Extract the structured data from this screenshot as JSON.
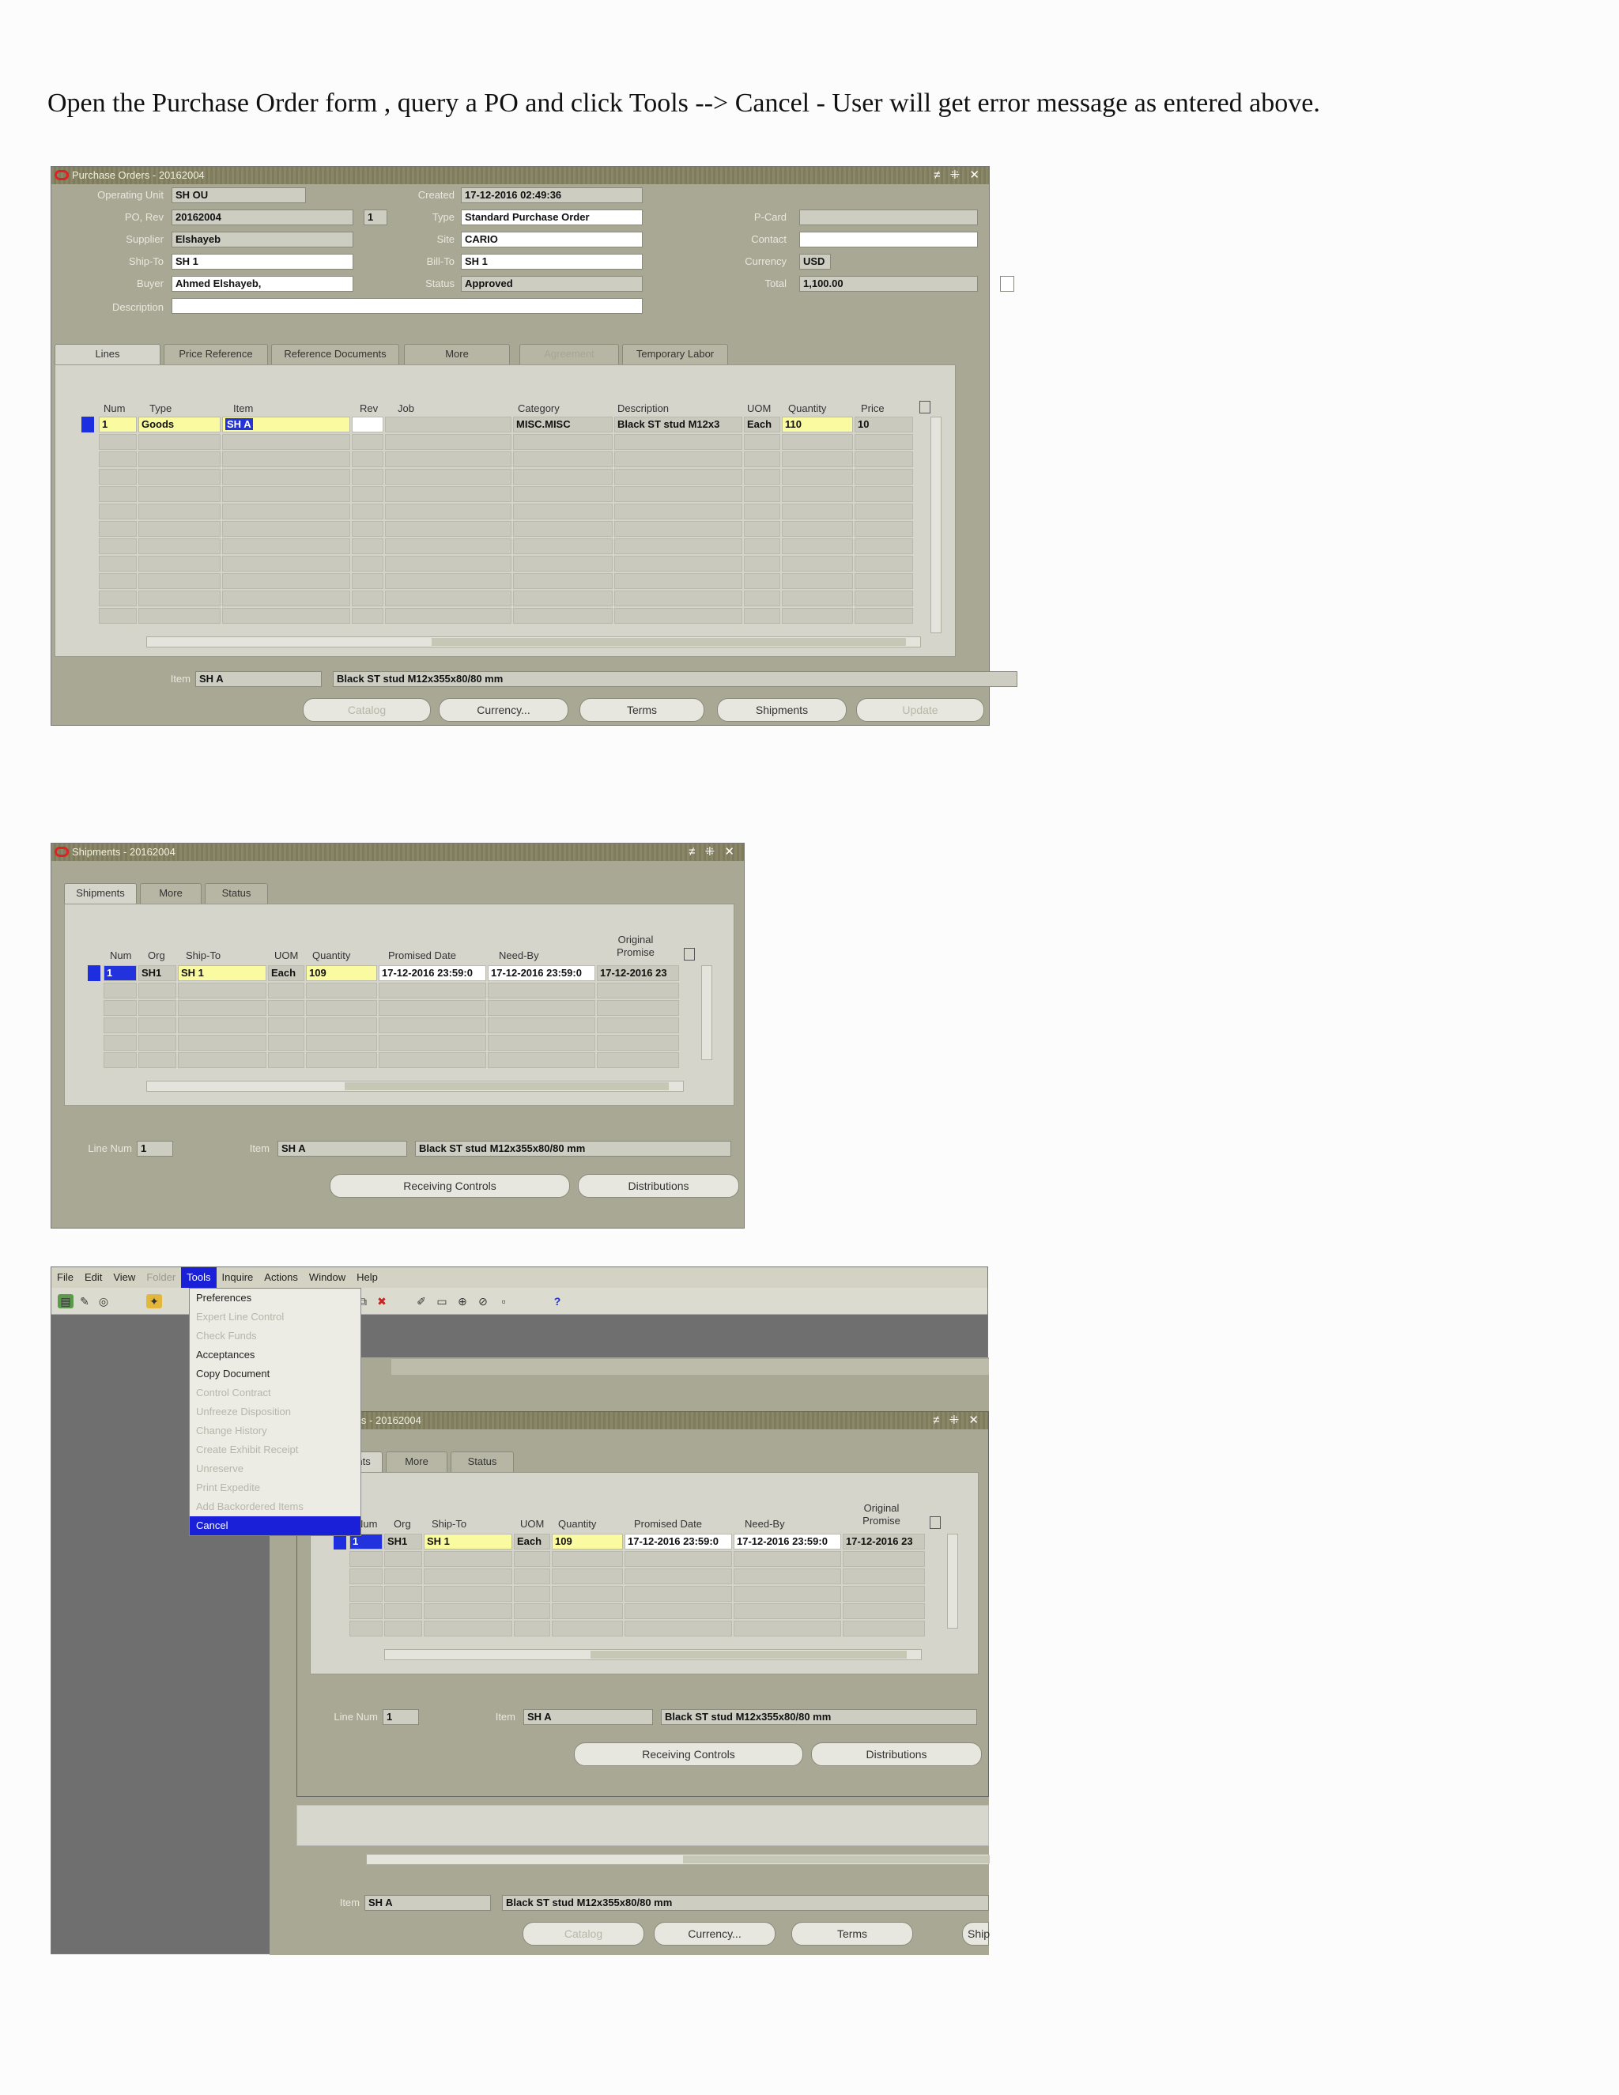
{
  "instruction": "Open the Purchase Order form , query a  PO and click Tools  --> Cancel - User will  get error message as entered above.",
  "po_form": {
    "title": "Purchase Orders - 20162004",
    "window_controls": "≠ ⁜ ✕",
    "labels": {
      "operating_unit": "Operating Unit",
      "po_rev": "PO, Rev",
      "supplier": "Supplier",
      "ship_to": "Ship-To",
      "buyer": "Buyer",
      "description": "Description",
      "created": "Created",
      "type": "Type",
      "site": "Site",
      "bill_to": "Bill-To",
      "status": "Status",
      "pcard": "P-Card",
      "contact": "Contact",
      "currency": "Currency",
      "total": "Total"
    },
    "values": {
      "operating_unit": "SH OU",
      "po_number": "20162004",
      "revision": "1",
      "supplier": "Elshayeb",
      "ship_to": "SH 1",
      "buyer": "Ahmed Elshayeb,",
      "description": "",
      "created": "17-12-2016 02:49:36",
      "type": "Standard Purchase Order",
      "site": "CARIO",
      "bill_to": "SH 1",
      "status": "Approved",
      "pcard": "",
      "contact": "",
      "currency": "USD",
      "total": "1,100.00"
    },
    "tabs": [
      "Lines",
      "Price Reference",
      "Reference Documents",
      "More",
      "Agreement",
      "Temporary Labor"
    ],
    "columns": [
      "Num",
      "Type",
      "Item",
      "Rev",
      "Job",
      "Category",
      "Description",
      "UOM",
      "Quantity",
      "Price"
    ],
    "line": {
      "num": "1",
      "type": "Goods",
      "item": "SH A",
      "rev": "",
      "job": "",
      "category": "MISC.MISC",
      "description": "Black ST stud M12x3",
      "uom": "Each",
      "quantity": "110",
      "price": "10"
    },
    "footer_item_label": "Item",
    "footer_item": "SH A",
    "footer_description": "Black ST stud M12x355x80/80 mm",
    "buttons": [
      "Catalog",
      "Currency...",
      "Terms",
      "Shipments",
      "Update"
    ]
  },
  "shipments_form": {
    "title": "Shipments - 20162004",
    "window_controls": "≠ ⁜ ✕",
    "tabs": [
      "Shipments",
      "More",
      "Status"
    ],
    "columns": [
      "Num",
      "Org",
      "Ship-To",
      "UOM",
      "Quantity",
      "Promised Date",
      "Need-By",
      "Original Promise"
    ],
    "row": {
      "num": "1",
      "org": "SH1",
      "ship_to": "SH 1",
      "uom": "Each",
      "quantity": "109",
      "promised_date": "17-12-2016 23:59:0",
      "need_by": "17-12-2016 23:59:0",
      "original_promise": "17-12-2016 23"
    },
    "line_num_label": "Line Num",
    "line_num": "1",
    "item_label": "Item",
    "item": "SH A",
    "item_description": "Black ST stud M12x355x80/80 mm",
    "buttons": [
      "Receiving Controls",
      "Distributions"
    ]
  },
  "menu_screen": {
    "menubar": [
      "File",
      "Edit",
      "View",
      "Folder",
      "Tools",
      "Inquire",
      "Actions",
      "Window",
      "Help"
    ],
    "tools_menu": [
      {
        "label": "Preferences",
        "enabled": true
      },
      {
        "label": "Expert Line Control",
        "enabled": false
      },
      {
        "label": "Check Funds",
        "enabled": false
      },
      {
        "label": "Acceptances",
        "enabled": true
      },
      {
        "label": "Copy Document",
        "enabled": true
      },
      {
        "label": "Control Contract",
        "enabled": false
      },
      {
        "label": "Unfreeze Disposition",
        "enabled": false
      },
      {
        "label": "Change History",
        "enabled": false
      },
      {
        "label": "Create Exhibit Receipt",
        "enabled": false
      },
      {
        "label": "Unreserve",
        "enabled": false
      },
      {
        "label": "Print Expedite",
        "enabled": false
      },
      {
        "label": "Add Backordered Items",
        "enabled": false
      },
      {
        "label": "Cancel",
        "enabled": true
      }
    ],
    "behind_item": "SH A",
    "behind_description": "Black ST stud M12x355x80/80 mm",
    "behind_buttons": [
      "Catalog",
      "Currency...",
      "Terms",
      "Ship"
    ]
  }
}
